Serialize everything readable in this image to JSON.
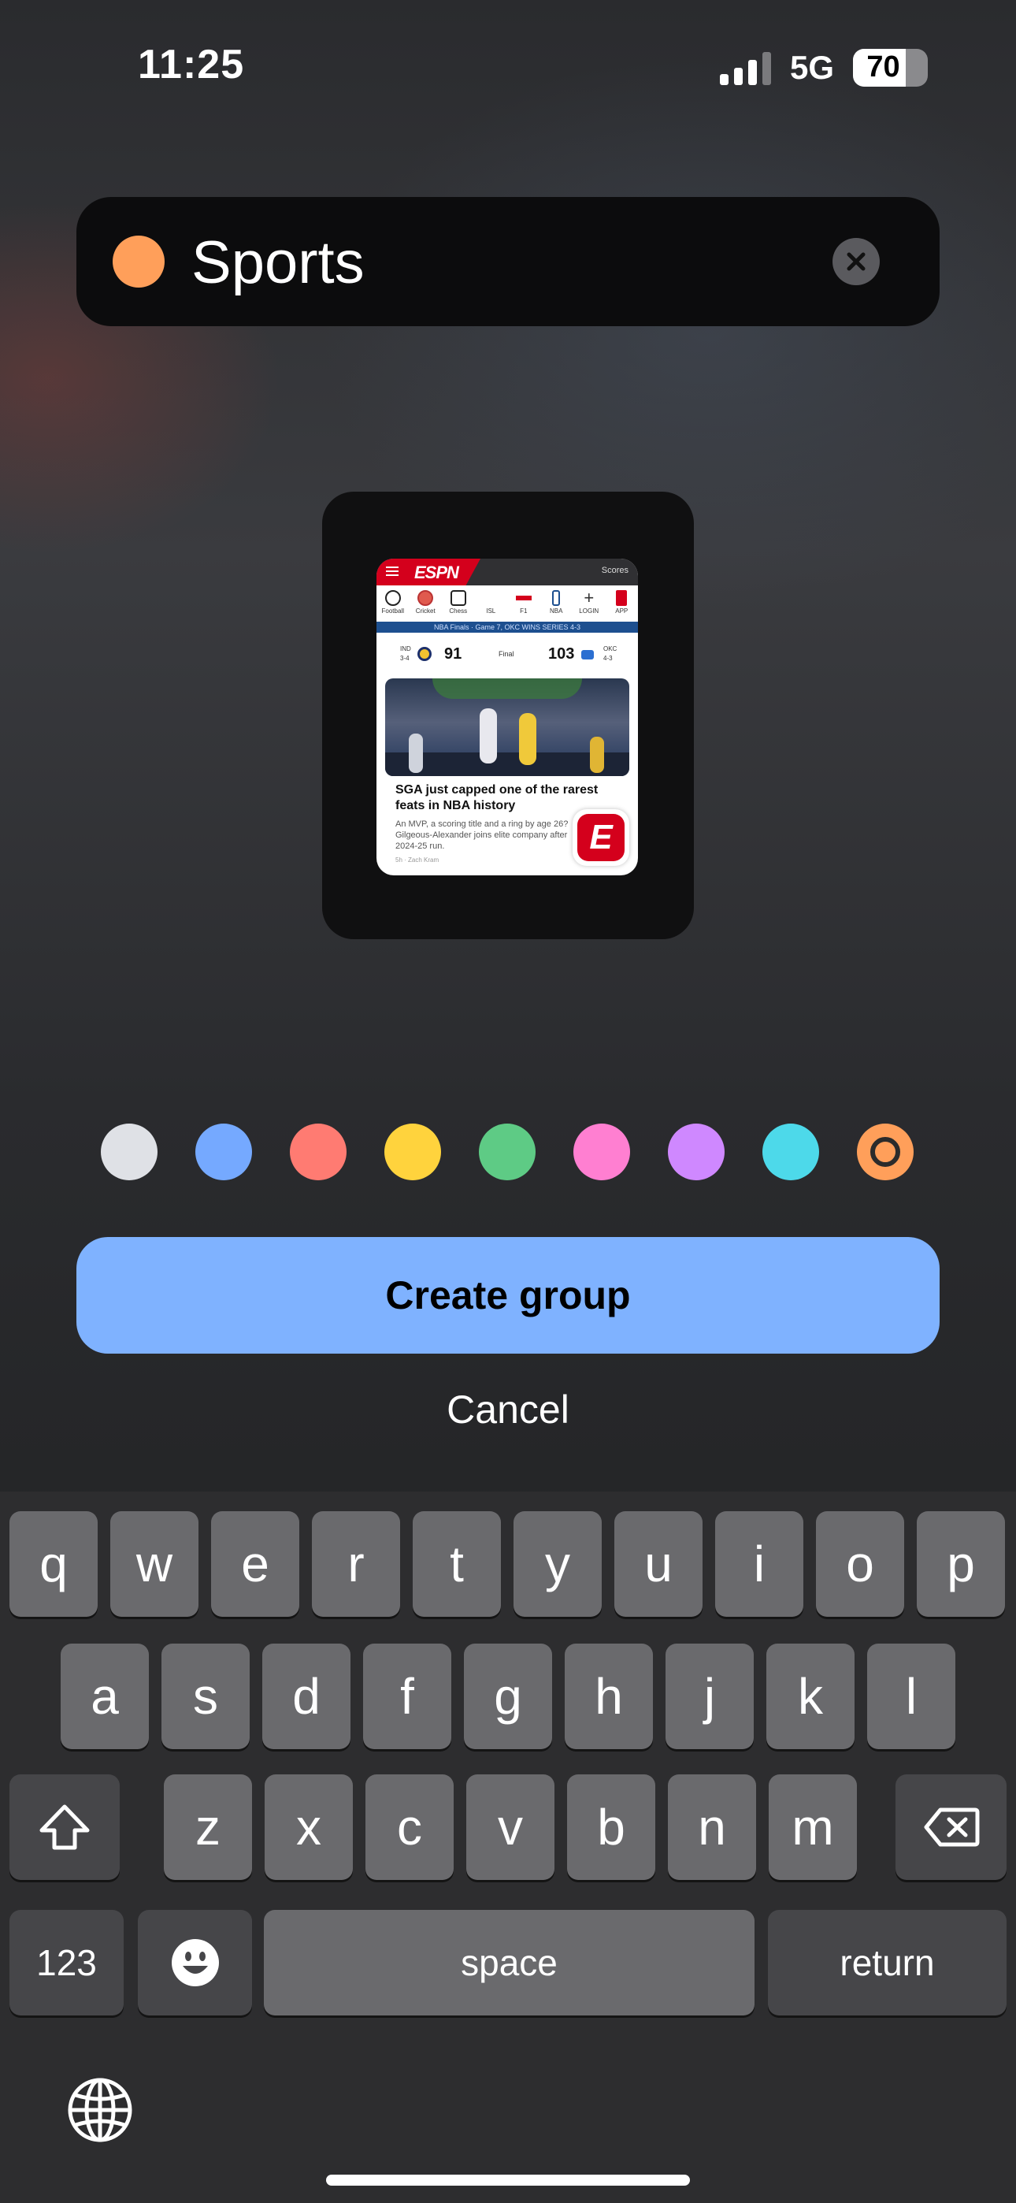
{
  "status_bar": {
    "time": "11:25",
    "network": "5G",
    "battery": "70",
    "battery_level": 0.7
  },
  "group_name": {
    "value": "Sports",
    "dot_color": "#ff9f5a",
    "clear_icon": "xmark-circle-icon"
  },
  "preview": {
    "app": "ESPN",
    "scores_label": "Scores",
    "sports": [
      "Football",
      "Cricket",
      "Chess",
      "ISL",
      "F1",
      "NBA",
      "LOGIN",
      "APP"
    ],
    "banner": "NBA Finals · Game 7, OKC WINS SERIES 4-3",
    "team1_abbr": "IND",
    "team1_record": "3-4",
    "team1_score": "91",
    "status": "Final",
    "team2_abbr": "OKC",
    "team2_record": "4-3",
    "team2_score": "103",
    "headline": "SGA just capped one of the rarest feats in NBA history",
    "summary": "An MVP, a scoring title and a ring by age 26? Gilgeous-Alexander joins elite company after 2024-25 run.",
    "byline": "5h · Zach Kram"
  },
  "colors": [
    "#dfe1e6",
    "#75a9ff",
    "#ff7b72",
    "#ffd33d",
    "#5ecb85",
    "#ff7fd1",
    "#cf88ff",
    "#4dd9ea",
    "#ff9f5a"
  ],
  "selected_color_index": 8,
  "actions": {
    "create": "Create group",
    "cancel": "Cancel"
  },
  "keyboard": {
    "row1": [
      "q",
      "w",
      "e",
      "r",
      "t",
      "y",
      "u",
      "i",
      "o",
      "p"
    ],
    "row2": [
      "a",
      "s",
      "d",
      "f",
      "g",
      "h",
      "j",
      "k",
      "l"
    ],
    "row3": [
      "z",
      "x",
      "c",
      "v",
      "b",
      "n",
      "m"
    ],
    "numbers": "123",
    "space": "space",
    "return": "return"
  }
}
